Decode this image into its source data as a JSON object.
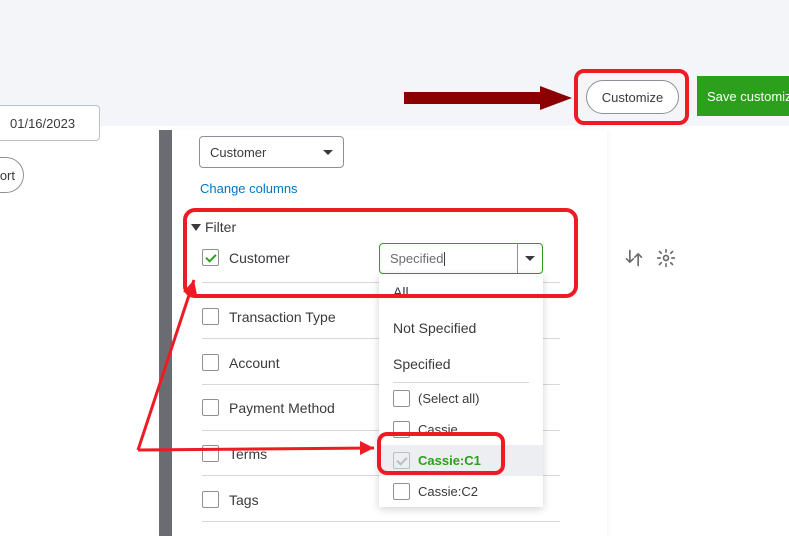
{
  "header": {
    "customize_label": "Customize",
    "save_custom_label": "Save customiza"
  },
  "inputs": {
    "date_value": "01/16/2023",
    "report_btn_partial": "ort"
  },
  "panel": {
    "grouping_select_value": "Customer",
    "change_columns_label": "Change columns",
    "filter_header": "Filter",
    "customer_filter_label": "Customer",
    "customer_filter_value": "Specified",
    "filters": {
      "transaction_type": "Transaction Type",
      "account": "Account",
      "payment_method": "Payment Method",
      "terms": "Terms",
      "tags": "Tags"
    }
  },
  "dropdown": {
    "opt_all": "All",
    "opt_not_specified": "Not Specified",
    "opt_specified": "Specified",
    "select_all": "(Select all)",
    "items": {
      "cassie": "Cassie",
      "cassie_c1": "Cassie:C1",
      "cassie_c2": "Cassie:C2"
    }
  }
}
